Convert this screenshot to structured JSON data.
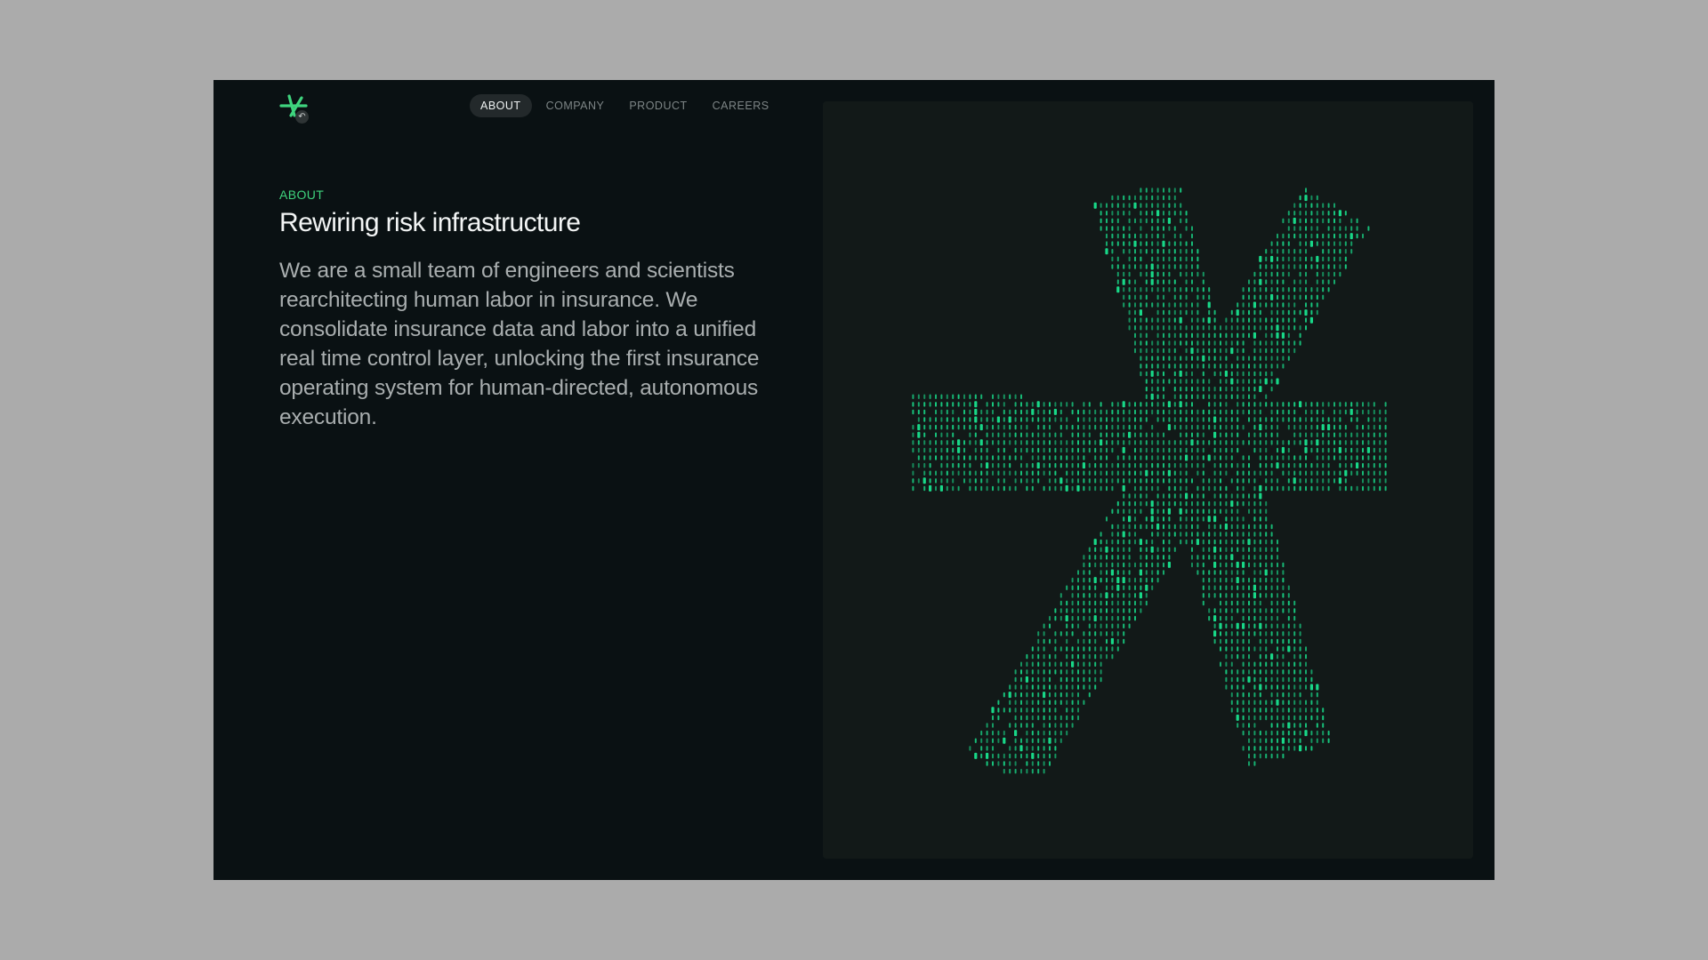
{
  "logo": {
    "icon": "asterisk-logo-icon",
    "badge_icon": "undo-icon",
    "badge_glyph": "↶",
    "color": "#3fd47e"
  },
  "nav": {
    "items": [
      {
        "label": "ABOUT",
        "active": true
      },
      {
        "label": "COMPANY",
        "active": false
      },
      {
        "label": "PRODUCT",
        "active": false
      },
      {
        "label": "CAREERS",
        "active": false
      }
    ]
  },
  "hero": {
    "eyebrow": "ABOUT",
    "title": "Rewiring risk infrastructure",
    "body": "We are a small team of engineers and scientists rearchitecting human labor in insurance. We consolidate insurance data and labor into a unified real time control layer, unlocking the first insurance operating system for human-directed, autonomous execution."
  },
  "graphic": {
    "name": "dot-matrix-asterisk",
    "color": "#18d888",
    "background": "#121918"
  },
  "colors": {
    "accent": "#3fd47e",
    "page_background": "#0a1113",
    "outer_background": "#ababab"
  }
}
